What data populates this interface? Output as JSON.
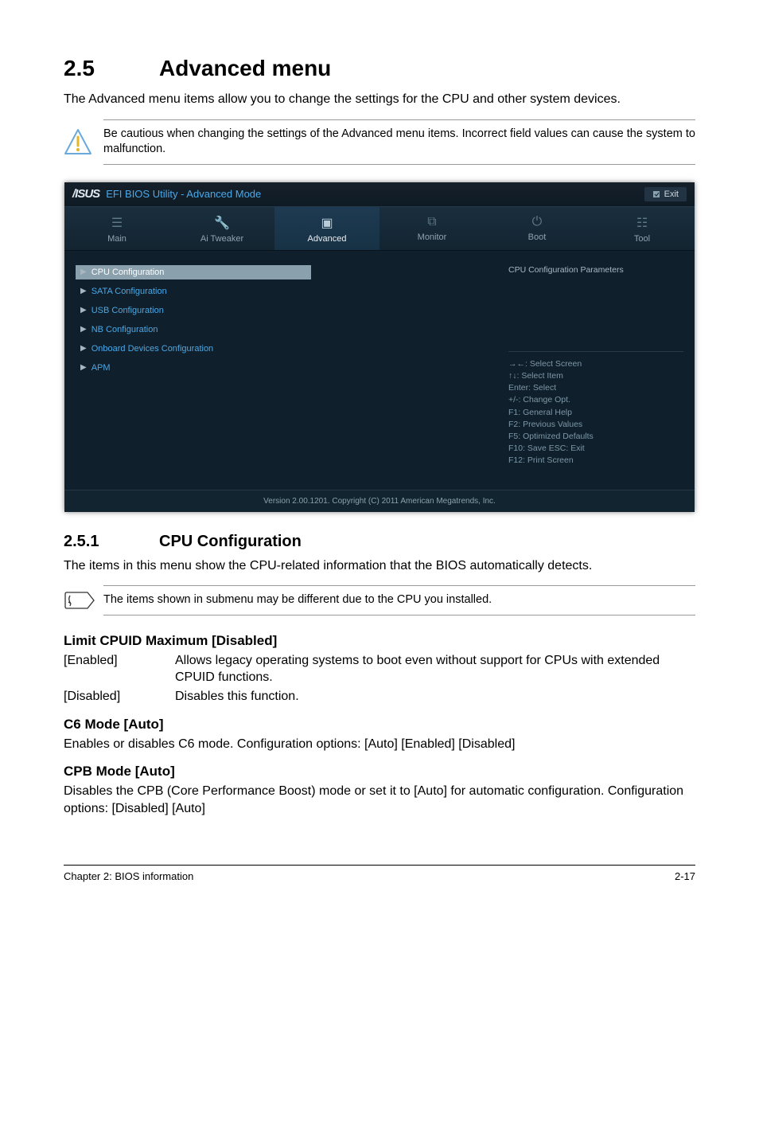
{
  "section": {
    "number": "2.5",
    "title": "Advanced menu"
  },
  "intro": "The Advanced menu items allow you to change the settings for the CPU and other system devices.",
  "warning": "Be cautious when changing the settings of the Advanced menu items. Incorrect field values can cause the system to malfunction.",
  "bios": {
    "logo": "/ISUS",
    "title": "EFI BIOS Utility - Advanced Mode",
    "exit": "Exit",
    "tabs": {
      "main": "Main",
      "ai_tweaker": "Ai Tweaker",
      "advanced": "Advanced",
      "monitor": "Monitor",
      "boot": "Boot",
      "tool": "Tool"
    },
    "menu_items": [
      "CPU Configuration",
      "SATA Configuration",
      "USB Configuration",
      "NB Configuration",
      "Onboard Devices Configuration",
      "APM"
    ],
    "right_title": "CPU Configuration Parameters",
    "help": {
      "l1": "→←: Select Screen",
      "l2": "↑↓: Select Item",
      "l3": "Enter: Select",
      "l4": "+/-: Change Opt.",
      "l5": "F1: General Help",
      "l6": "F2: Previous Values",
      "l7": "F5: Optimized Defaults",
      "l8": "F10: Save   ESC: Exit",
      "l9": "F12: Print Screen"
    },
    "footer": "Version 2.00.1201.  Copyright (C) 2011 American Megatrends, Inc."
  },
  "sub": {
    "number": "2.5.1",
    "title": "CPU Configuration",
    "descr": "The items in this menu show the CPU-related information that the BIOS automatically detects.",
    "note": "The items shown in submenu may be different due to the CPU you installed."
  },
  "opt1": {
    "title": "Limit CPUID Maximum [Disabled]",
    "enabled_k": "[Enabled]",
    "enabled_v": "Allows legacy operating systems to boot even without support for CPUs with extended CPUID functions.",
    "disabled_k": "[Disabled]",
    "disabled_v": "Disables this function."
  },
  "opt2": {
    "title": "C6 Mode [Auto]",
    "descr": "Enables or disables C6 mode. Configuration options: [Auto] [Enabled] [Disabled]"
  },
  "opt3": {
    "title": "CPB Mode [Auto]",
    "descr": "Disables the CPB (Core Performance Boost) mode or set it to [Auto] for automatic configuration. Configuration options: [Disabled] [Auto]"
  },
  "footer": {
    "left": "Chapter 2: BIOS information",
    "right": "2-17"
  }
}
